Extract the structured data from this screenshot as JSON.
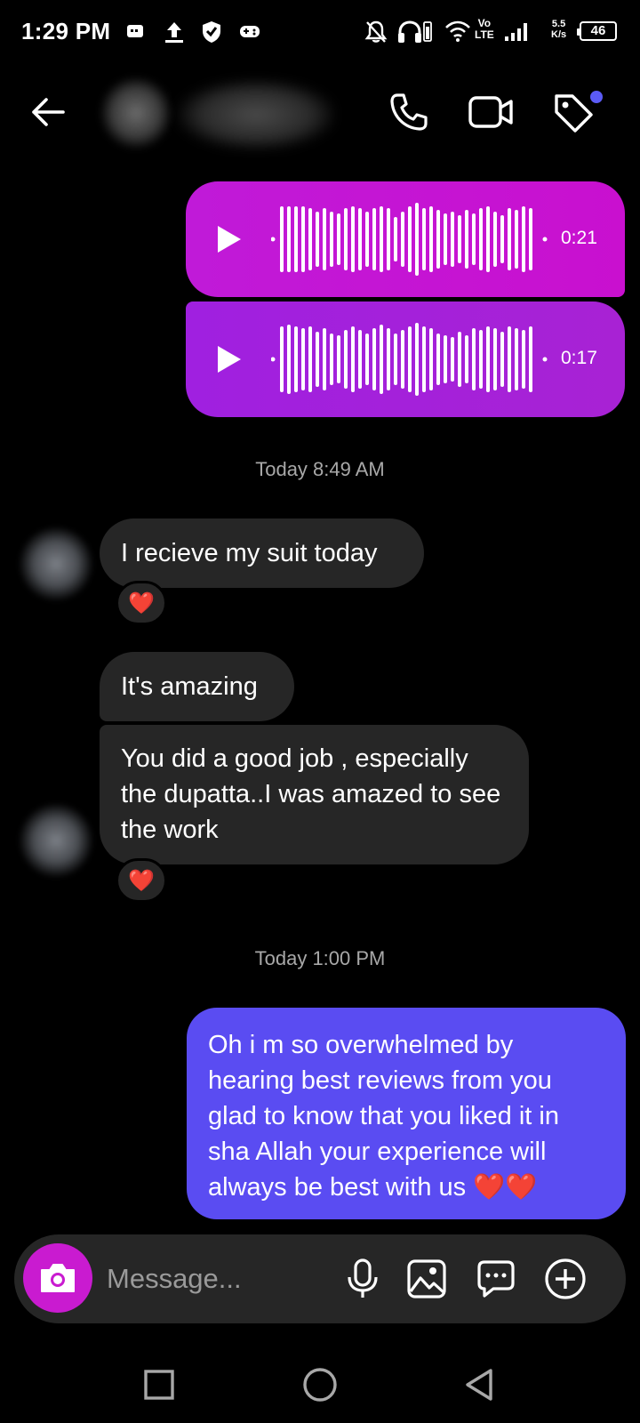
{
  "status_bar": {
    "time": "1:29 PM",
    "net_speed_value": "5.5",
    "net_speed_unit": "K/s",
    "volte_label": "Vo",
    "lte_label": "LTE",
    "battery": "46"
  },
  "header": {
    "back_icon": "arrow-left-icon",
    "call_icon": "phone-icon",
    "video_icon": "video-camera-icon",
    "tag_icon": "tag-icon"
  },
  "messages": {
    "voice_1": {
      "duration": "0:21"
    },
    "voice_2": {
      "duration": "0:17"
    },
    "timestamp_1": "Today 8:49 AM",
    "in_1": {
      "text": "I recieve my suit today",
      "reaction": "❤️"
    },
    "in_2": {
      "text": "It's amazing"
    },
    "in_3": {
      "text": "You did a good job , especially the dupatta..I was amazed to see the work",
      "reaction": "❤️"
    },
    "timestamp_2": "Today 1:00 PM",
    "out_1": {
      "text": "Oh i m so overwhelmed by hearing best reviews from you glad to know that you liked it in sha Allah your experience will always be best with us ❤️❤️"
    }
  },
  "composer": {
    "placeholder": "Message...",
    "camera_icon": "camera-icon",
    "mic_icon": "microphone-icon",
    "gallery_icon": "image-icon",
    "sticker_icon": "chat-bubble-icon",
    "plus_icon": "plus-circle-icon"
  },
  "colors": {
    "background": "#000000",
    "incoming_bubble": "#262626",
    "outgoing_bubble": "#5a4cf2",
    "voice_bubble_1": "#c01ad8",
    "voice_bubble_2": "#a020e0",
    "camera_button": "#c91bd0",
    "notification_dot": "#5b5bf5"
  }
}
